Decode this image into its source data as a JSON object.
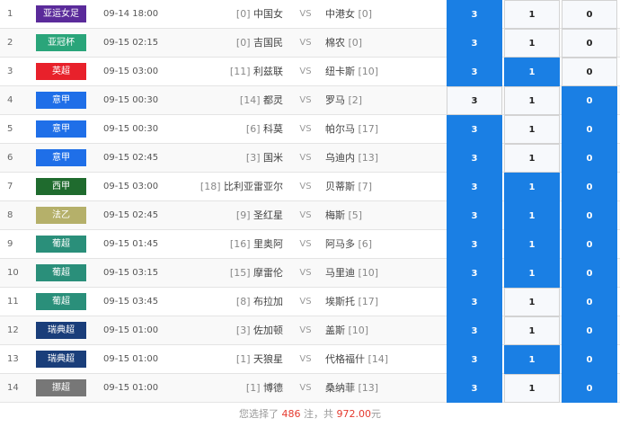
{
  "matches": [
    {
      "idx": "1",
      "league": "亚运女足",
      "color": "#5a2a9a",
      "time": "09-14 18:00",
      "home_rank": "[0]",
      "home": "中国女",
      "vs": "VS",
      "away": "中港女",
      "away_rank": "[0]",
      "sel": [
        "3",
        "1",
        "0"
      ],
      "on": [
        true,
        false,
        false
      ]
    },
    {
      "idx": "2",
      "league": "亚冠杯",
      "color": "#2aa57a",
      "time": "09-15 02:15",
      "home_rank": "[0]",
      "home": "吉国民",
      "vs": "VS",
      "away": "棉农",
      "away_rank": "[0]",
      "sel": [
        "3",
        "1",
        "0"
      ],
      "on": [
        true,
        false,
        false
      ]
    },
    {
      "idx": "3",
      "league": "英超",
      "color": "#e8212b",
      "time": "09-15 03:00",
      "home_rank": "[11]",
      "home": "利兹联",
      "vs": "VS",
      "away": "纽卡斯",
      "away_rank": "[10]",
      "sel": [
        "3",
        "1",
        "0"
      ],
      "on": [
        true,
        true,
        false
      ]
    },
    {
      "idx": "4",
      "league": "意甲",
      "color": "#1f6fe8",
      "time": "09-15 00:30",
      "home_rank": "[14]",
      "home": "都灵",
      "vs": "VS",
      "away": "罗马",
      "away_rank": "[2]",
      "sel": [
        "3",
        "1",
        "0"
      ],
      "on": [
        false,
        false,
        true
      ]
    },
    {
      "idx": "5",
      "league": "意甲",
      "color": "#1f6fe8",
      "time": "09-15 00:30",
      "home_rank": "[6]",
      "home": "科莫",
      "vs": "VS",
      "away": "帕尔马",
      "away_rank": "[17]",
      "sel": [
        "3",
        "1",
        "0"
      ],
      "on": [
        true,
        false,
        true
      ]
    },
    {
      "idx": "6",
      "league": "意甲",
      "color": "#1f6fe8",
      "time": "09-15 02:45",
      "home_rank": "[3]",
      "home": "国米",
      "vs": "VS",
      "away": "乌迪内",
      "away_rank": "[13]",
      "sel": [
        "3",
        "1",
        "0"
      ],
      "on": [
        true,
        false,
        true
      ]
    },
    {
      "idx": "7",
      "league": "西甲",
      "color": "#1f6b2e",
      "time": "09-15 03:00",
      "home_rank": "[18]",
      "home": "比利亚雷亚尔",
      "vs": "VS",
      "away": "贝蒂斯",
      "away_rank": "[7]",
      "sel": [
        "3",
        "1",
        "0"
      ],
      "on": [
        true,
        true,
        true
      ]
    },
    {
      "idx": "8",
      "league": "法乙",
      "color": "#b5b06a",
      "time": "09-15 02:45",
      "home_rank": "[9]",
      "home": "圣红星",
      "vs": "VS",
      "away": "梅斯",
      "away_rank": "[5]",
      "sel": [
        "3",
        "1",
        "0"
      ],
      "on": [
        true,
        true,
        true
      ]
    },
    {
      "idx": "9",
      "league": "葡超",
      "color": "#2a8f7a",
      "time": "09-15 01:45",
      "home_rank": "[16]",
      "home": "里奥阿",
      "vs": "VS",
      "away": "阿马多",
      "away_rank": "[6]",
      "sel": [
        "3",
        "1",
        "0"
      ],
      "on": [
        true,
        true,
        true
      ]
    },
    {
      "idx": "10",
      "league": "葡超",
      "color": "#2a8f7a",
      "time": "09-15 03:15",
      "home_rank": "[15]",
      "home": "摩雷伦",
      "vs": "VS",
      "away": "马里迪",
      "away_rank": "[10]",
      "sel": [
        "3",
        "1",
        "0"
      ],
      "on": [
        true,
        true,
        true
      ]
    },
    {
      "idx": "11",
      "league": "葡超",
      "color": "#2a8f7a",
      "time": "09-15 03:45",
      "home_rank": "[8]",
      "home": "布拉加",
      "vs": "VS",
      "away": "埃斯托",
      "away_rank": "[17]",
      "sel": [
        "3",
        "1",
        "0"
      ],
      "on": [
        true,
        false,
        true
      ]
    },
    {
      "idx": "12",
      "league": "瑞典超",
      "color": "#1a3e7a",
      "time": "09-15 01:00",
      "home_rank": "[3]",
      "home": "佐加顿",
      "vs": "VS",
      "away": "盖斯",
      "away_rank": "[10]",
      "sel": [
        "3",
        "1",
        "0"
      ],
      "on": [
        true,
        false,
        true
      ]
    },
    {
      "idx": "13",
      "league": "瑞典超",
      "color": "#1a3e7a",
      "time": "09-15 01:00",
      "home_rank": "[1]",
      "home": "天狼星",
      "vs": "VS",
      "away": "代格福什",
      "away_rank": "[14]",
      "sel": [
        "3",
        "1",
        "0"
      ],
      "on": [
        true,
        true,
        true
      ]
    },
    {
      "idx": "14",
      "league": "挪超",
      "color": "#777777",
      "time": "09-15 01:00",
      "home_rank": "[1]",
      "home": "博德",
      "vs": "VS",
      "away": "桑纳菲",
      "away_rank": "[13]",
      "sel": [
        "3",
        "1",
        "0"
      ],
      "on": [
        true,
        false,
        true
      ]
    }
  ],
  "footer": {
    "prefix": "您选择了 ",
    "count": "486",
    "mid": " 注，共 ",
    "amount": "972.00",
    "suffix": "元"
  }
}
